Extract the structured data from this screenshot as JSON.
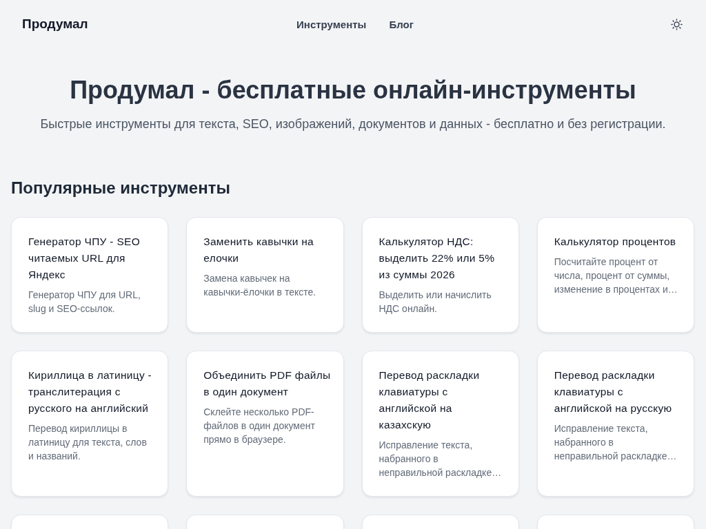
{
  "header": {
    "logo": "Продумал",
    "nav": [
      {
        "label": "Инструменты"
      },
      {
        "label": "Блог"
      }
    ],
    "dark_mode": false
  },
  "hero": {
    "title": "Продумал - бесплатные онлайн-инструменты",
    "subtitle": "Быстрые инструменты для текста, SEO, изображений, документов и данных - бесплатно и без регистрации."
  },
  "popular": {
    "heading": "Популярные инструменты",
    "cards": [
      {
        "title": "Генератор ЧПУ - SEO читаемых URL для Яндекс",
        "description": "Генератор ЧПУ для URL, slug и SEO-ссылок."
      },
      {
        "title": "Заменить кавычки на елочки",
        "description": "Замена кавычек на кавычки-ёлочки в тексте."
      },
      {
        "title": "Калькулятор НДС: выделить 22% или 5% из суммы 2026",
        "description": "Выделить или начислить НДС онлайн."
      },
      {
        "title": "Калькулятор процентов",
        "description": "Посчитайте процент от числа, процент от суммы, изменение в процентах и…"
      },
      {
        "title": "Кириллица в латиницу - транслитерация с русского на английский",
        "description": "Перевод кириллицы в латиницу для текста, слов и названий."
      },
      {
        "title": "Объединить PDF файлы в один документ",
        "description": "Склейте несколько PDF-файлов в один документ прямо в браузере."
      },
      {
        "title": "Перевод раскладки клавиатуры с английской на казахскую",
        "description": "Исправление текста, набранного в неправильной раскладке…"
      },
      {
        "title": "Перевод раскладки клавиатуры с английской на русскую",
        "description": "Исправление текста, набранного в неправильной раскладке…"
      }
    ],
    "more_rows_below": true
  }
}
